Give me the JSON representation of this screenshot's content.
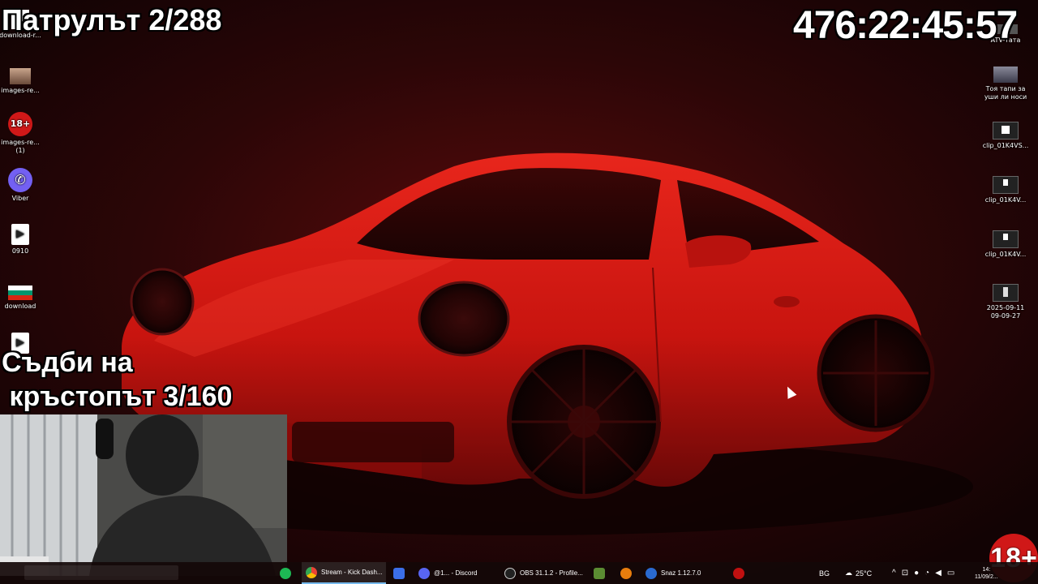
{
  "overlay": {
    "patrol_counter": "Патрулът 2/288",
    "timer": "476:22:45:57",
    "fate_line1": "Съдби на",
    "fate_line2": " кръстопът 3/160",
    "badge_18": "18+"
  },
  "desktop_left": [
    {
      "label": "download-r...",
      "icon": "download-icon"
    },
    {
      "label": "images-re...",
      "icon": "person-photo-icon"
    },
    {
      "label": "images-re... (1)",
      "icon": "18-plus-icon"
    },
    {
      "label": "Viber",
      "icon": "viber-icon"
    },
    {
      "label": "0910",
      "icon": "video-file-icon"
    },
    {
      "label": "download",
      "icon": "bulgaria-flag-icon"
    }
  ],
  "desktop_right": [
    {
      "label": "ATV-тата",
      "icon": "image-file-icon"
    },
    {
      "label": "Тоя тапи за уши ли носи",
      "icon": "image-file-icon"
    },
    {
      "label": "clip_01K4VS...",
      "icon": "video-file-icon"
    },
    {
      "label": "clip_01K4V...",
      "icon": "video-file-icon"
    },
    {
      "label": "clip_01K4V...",
      "icon": "video-file-icon"
    },
    {
      "label": "2025-09-11 09-09-27",
      "icon": "video-file-icon"
    }
  ],
  "taskbar": {
    "apps": [
      {
        "label": "Stream - Kick Dash...",
        "icon": "chrome-icon",
        "active": true
      },
      {
        "label": "",
        "icon": "roblox-icon"
      },
      {
        "label": "@1... - Discord",
        "icon": "discord-icon"
      },
      {
        "label": "OBS 31.1.2 - Profile...",
        "icon": "obs-icon"
      },
      {
        "label": "",
        "icon": "minecraft-icon"
      },
      {
        "label": "",
        "icon": "blender-icon"
      },
      {
        "label": "Snaz 1.12.7.0",
        "icon": "snaz-icon"
      },
      {
        "label": "",
        "icon": "record-icon"
      }
    ],
    "tray": {
      "language": "BG",
      "temperature": "25°C",
      "time": "14:",
      "date": "11/09/2..."
    }
  },
  "colors": {
    "wallpaper_bg": "#1a0405",
    "car_red": "#d41a14",
    "accent_blue": "#76b9ed",
    "badge_red": "#d01818"
  }
}
